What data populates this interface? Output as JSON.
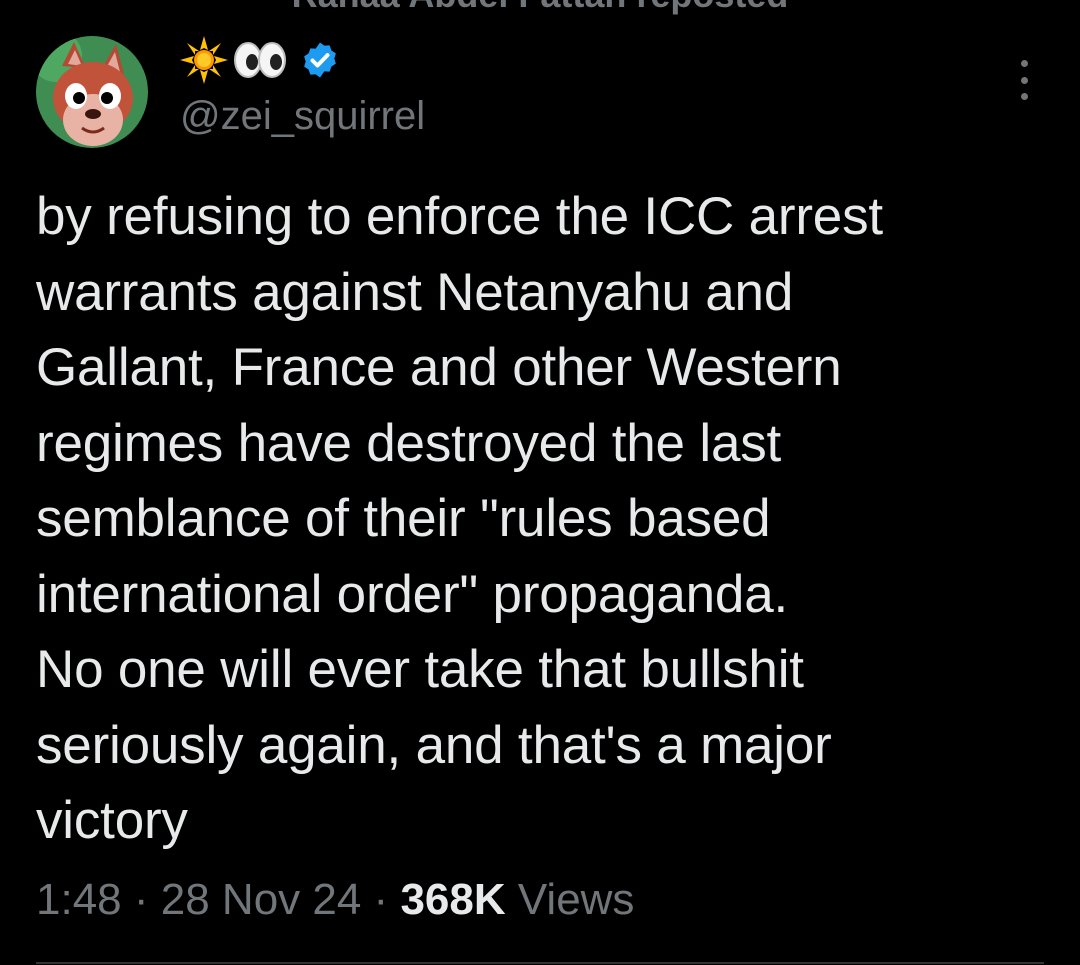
{
  "repost": {
    "text": "Rahaa Abdel Fattah reposted"
  },
  "author": {
    "display_name_emojis": [
      "sun-emoji",
      "eyes-emoji"
    ],
    "verified": true,
    "handle": "@zei_squirrel",
    "avatar": "squirrel-cartoon-avatar"
  },
  "tweet": {
    "lines": [
      "by refusing to enforce the ICC arrest",
      "warrants against Netanyahu and",
      "Gallant, France and other Western",
      "regimes have destroyed the last",
      "semblance of their \"rules based",
      "international order\" propaganda.",
      "No one will ever take that bullshit",
      "seriously again, and that's a major",
      "victory"
    ]
  },
  "meta": {
    "time": "1:48",
    "separator": " · ",
    "date": "28 Nov 24",
    "views_count": "368K",
    "views_label": "Views"
  },
  "colors": {
    "background": "#000000",
    "text": "#e7e9ea",
    "secondary_text": "#71767b",
    "verified_badge": "#1d9bf0",
    "divider": "#2f3336"
  }
}
